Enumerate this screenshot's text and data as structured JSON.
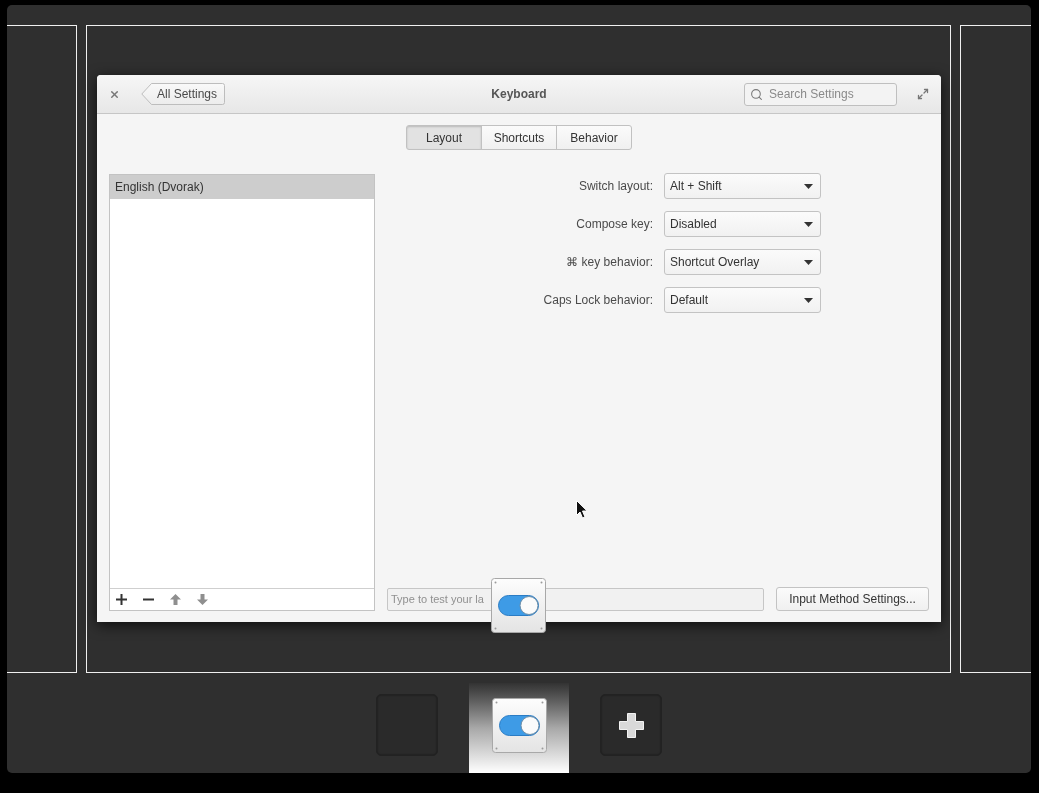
{
  "window": {
    "title": "Keyboard",
    "back_button": "All Settings",
    "search": {
      "placeholder": "Search Settings"
    }
  },
  "tabs": [
    {
      "label": "Layout",
      "selected": true
    },
    {
      "label": "Shortcuts",
      "selected": false
    },
    {
      "label": "Behavior",
      "selected": false
    }
  ],
  "layouts": [
    {
      "label": "English (Dvorak)",
      "selected": true
    }
  ],
  "list_toolbar": [
    {
      "kind": "add",
      "disabled": false
    },
    {
      "kind": "remove",
      "disabled": false
    },
    {
      "kind": "move_up",
      "disabled": true
    },
    {
      "kind": "move_down",
      "disabled": true
    }
  ],
  "settings": [
    {
      "label": "Switch layout:",
      "value": "Alt + Shift"
    },
    {
      "label": "Compose key:",
      "value": "Disabled"
    },
    {
      "label": "⌘ key behavior:",
      "value": "Shortcut Overlay"
    },
    {
      "label": "Caps Lock behavior:",
      "value": "Default"
    }
  ],
  "test_field": {
    "placeholder": "Type to test your la"
  },
  "input_method_button": "Input Method Settings...",
  "workspaces": [
    {
      "kind": "empty",
      "selected": false
    },
    {
      "kind": "app",
      "selected": true
    },
    {
      "kind": "add",
      "selected": false
    }
  ]
}
